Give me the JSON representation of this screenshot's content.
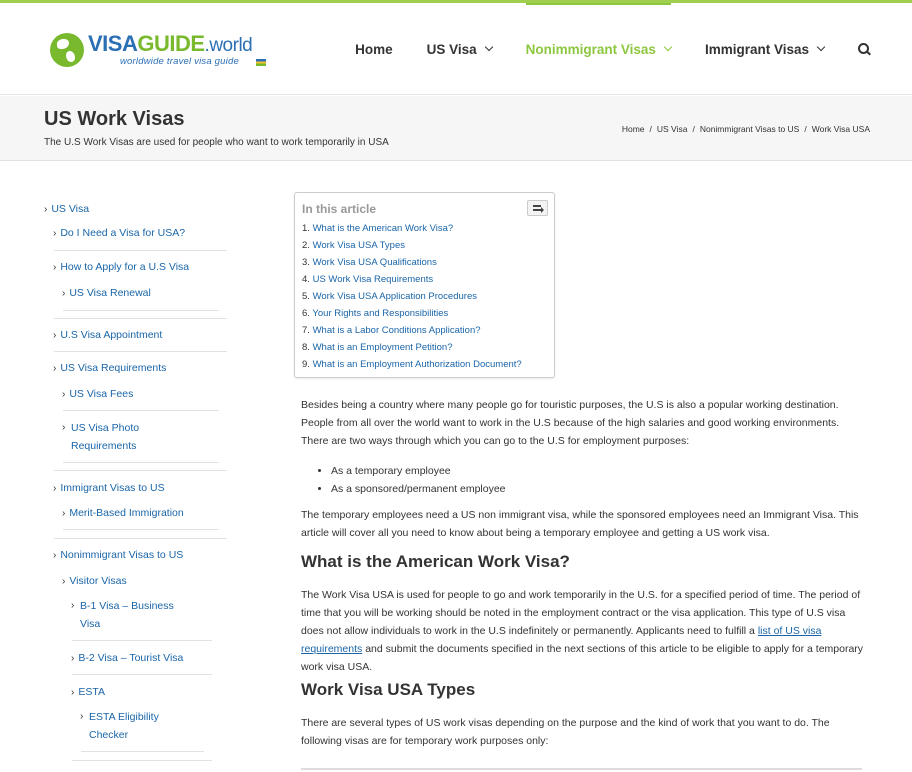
{
  "logo": {
    "word_visa": "VISA",
    "word_guide": "GUIDE",
    "word_world": ".world",
    "tagline": "worldwide travel visa guide"
  },
  "nav": {
    "items": [
      {
        "label": "Home"
      },
      {
        "label": "US Visa"
      },
      {
        "label": "Nonimmigrant Visas"
      },
      {
        "label": "Immigrant Visas"
      }
    ]
  },
  "page": {
    "title": "US Work Visas",
    "subtitle": "The U.S Work Visas are used for people who want to work temporarily in USA"
  },
  "breadcrumb": [
    "Home",
    "US Visa",
    "Nonimmigrant Visas to US",
    "Work Visa USA"
  ],
  "sidebar": {
    "items": [
      {
        "label": "US Visa"
      },
      {
        "label": "Do I Need a Visa for USA?"
      },
      {
        "label": "How to Apply for a U.S Visa"
      },
      {
        "label": "US Visa Renewal"
      },
      {
        "label": "U.S Visa Appointment"
      },
      {
        "label": "US Visa Requirements"
      },
      {
        "label": "US Visa Fees"
      },
      {
        "label": "US Visa Photo Requirements"
      },
      {
        "label": "Immigrant Visas to US"
      },
      {
        "label": "Merit-Based Immigration"
      },
      {
        "label": "Nonimmigrant Visas to US"
      },
      {
        "label": "Visitor Visas"
      },
      {
        "label": "B-1 Visa – Business Visa"
      },
      {
        "label": "B-2 Visa – Tourist Visa"
      },
      {
        "label": "ESTA"
      },
      {
        "label": "ESTA Eligibility Checker"
      }
    ]
  },
  "toc": {
    "title": "In this article",
    "items": [
      {
        "num": "1.",
        "label": "What is the American Work Visa?"
      },
      {
        "num": "2.",
        "label": "Work Visa USA Types"
      },
      {
        "num": "3.",
        "label": "Work Visa USA Qualifications"
      },
      {
        "num": "4.",
        "label": "US Work Visa Requirements"
      },
      {
        "num": "5.",
        "label": "Work Visa USA Application Procedures"
      },
      {
        "num": "6.",
        "label": "Your Rights and Responsibilities"
      },
      {
        "num": "7.",
        "label": "What is a Labor Conditions Application?"
      },
      {
        "num": "8.",
        "label": "What is an Employment Petition?"
      },
      {
        "num": "9.",
        "label": "What is an Employment Authorization Document?"
      }
    ]
  },
  "content": {
    "intro": "Besides being a country where many people go for touristic purposes, the U.S is also a popular working destination. People from all over the world want to work in the U.S because of the high salaries and good working environments. There are two ways through which you can go to the U.S for employment purposes:",
    "bullets": [
      "As a temporary employee",
      "As a sponsored/permanent employee"
    ],
    "para2": "The temporary employees need a US non immigrant visa, while the sponsored employees need an Immigrant Visa. This article will cover all you need to know about being a temporary employee and getting a US work visa.",
    "h2_1": "What is the American Work Visa?",
    "para3_before": "The Work Visa USA is used for people to go and work temporarily in the U.S. for a specified period of time. The period of time that you will be working should be noted in the employment contract or the visa application. This type of U.S visa does not allow individuals to work in the U.S indefinitely or permanently. Applicants need to fulfill a ",
    "para3_link": "list of US visa requirements",
    "para3_after": " and submit the documents specified in the next sections of this article to be eligible to apply for a temporary work visa USA.",
    "h2_2": "Work Visa USA Types",
    "para4": "There are several types of US work visas depending on the purpose and the kind of work that you want to do. The following visas are for temporary work purposes only:"
  },
  "colors": {
    "accent_green": "#8dc63f",
    "link_blue": "#1a65a8",
    "logo_blue": "#2b6fb5"
  },
  "icons": [
    "search-icon",
    "chevron-down-icon",
    "toc-toggle-icon",
    "globe-icon",
    "caret-right-icon"
  ]
}
